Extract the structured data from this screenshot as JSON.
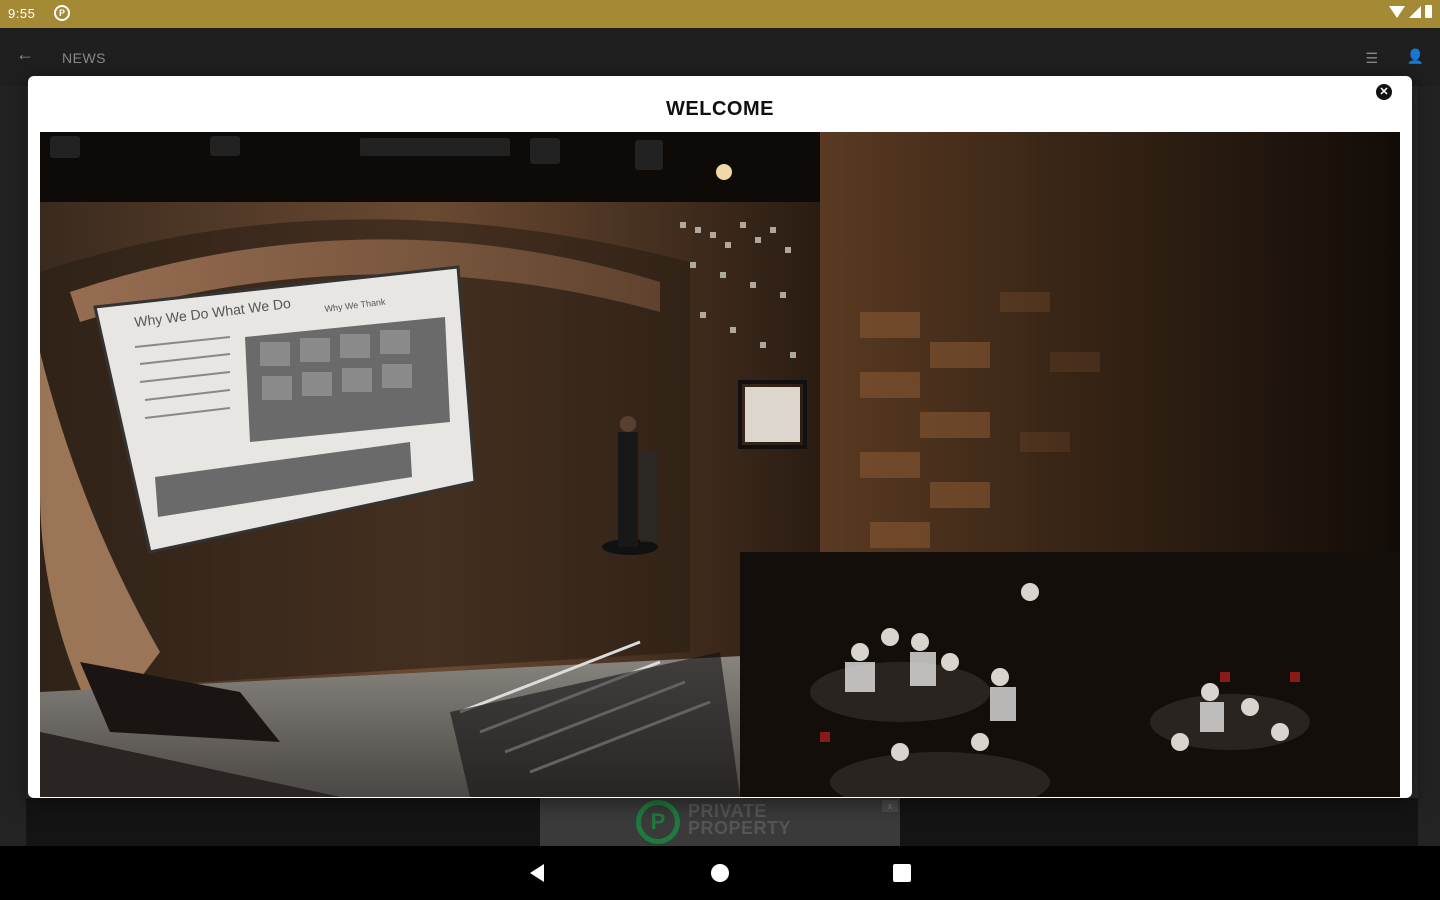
{
  "status_bar": {
    "time": "9:55",
    "notification_icon": "notification-icon"
  },
  "app_bar": {
    "back_icon": "arrow-back-icon",
    "title": "NEWS",
    "menu_icon": "menu-icon",
    "user_icon": "user-icon"
  },
  "dialog": {
    "title": "WELCOME",
    "close_icon": "close-circle-icon",
    "image": {
      "slide_heading": "Why We Do What We Do",
      "slide_subheading": "Why We Thank"
    }
  },
  "ad": {
    "logo_letter": "P",
    "brand_line1": "PRIVATE",
    "brand_line2": "PROPERTY",
    "close_label": "x"
  },
  "nav_bar": {
    "back": "nav-back-icon",
    "home": "nav-home-icon",
    "recents": "nav-recents-icon"
  },
  "colors": {
    "status_bar": "#a58a36",
    "ad_green": "#1f7a3e"
  }
}
